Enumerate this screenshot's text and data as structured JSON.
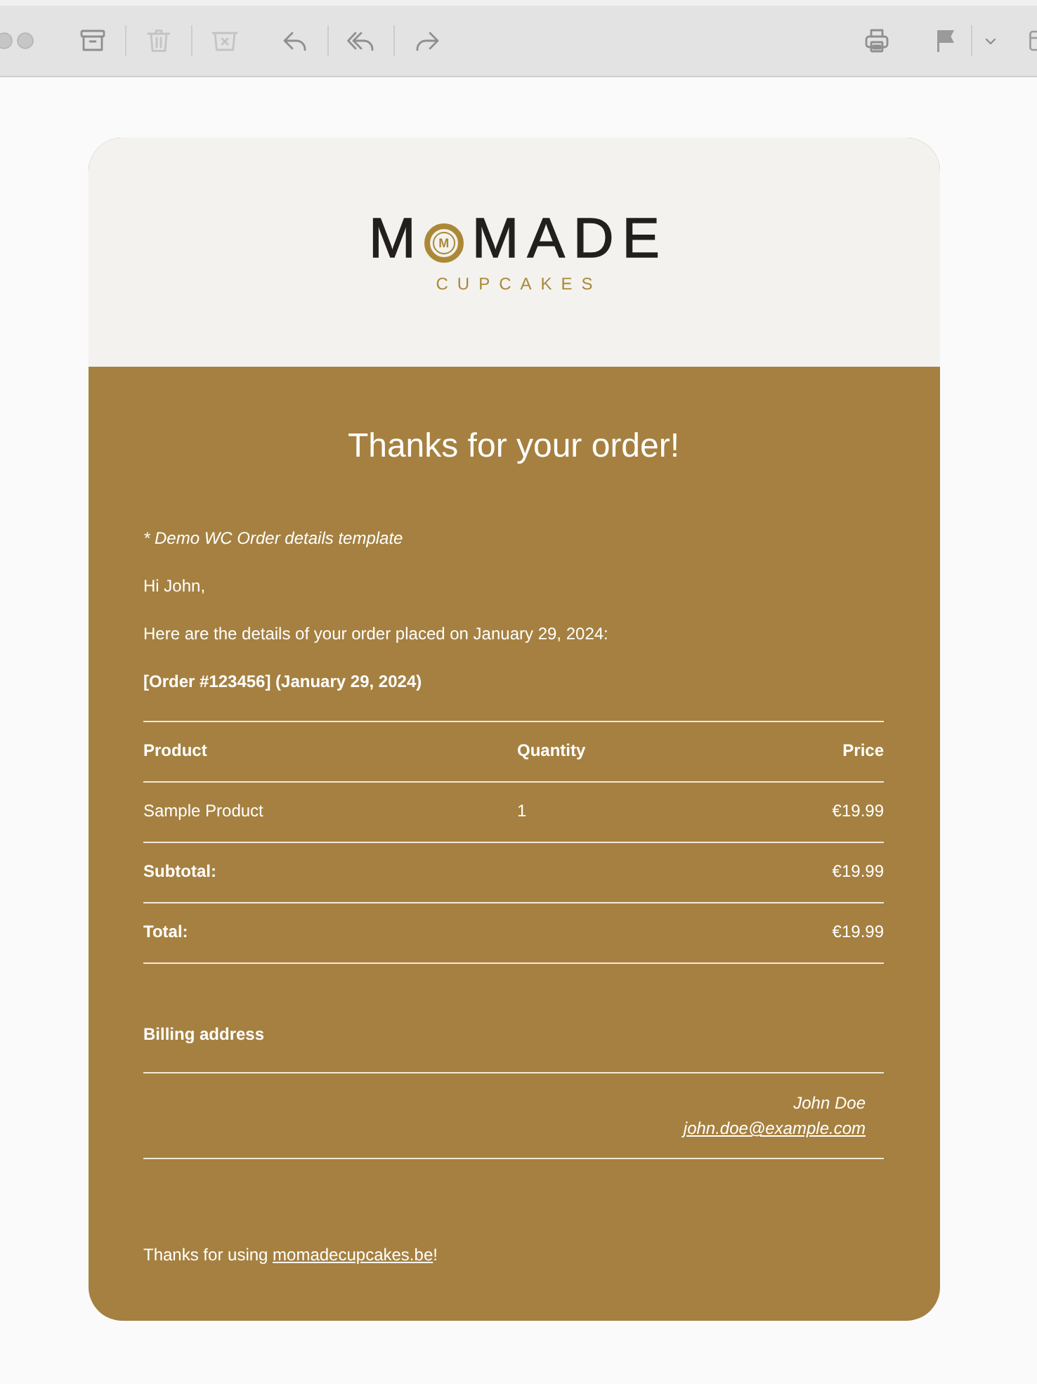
{
  "toolbar": {
    "left_groups": [
      {
        "buttons": [
          {
            "kind": "archive",
            "disabled": false
          },
          {
            "kind": "trash",
            "disabled": true
          },
          {
            "kind": "junk",
            "disabled": true
          }
        ]
      },
      {
        "buttons": [
          {
            "kind": "reply",
            "disabled": false
          },
          {
            "kind": "reply_all",
            "disabled": false
          },
          {
            "kind": "forward",
            "disabled": false
          }
        ]
      }
    ],
    "right_buttons": [
      {
        "kind": "print",
        "disabled": false
      },
      {
        "kind": "flag",
        "disabled": false
      },
      {
        "kind": "flag_menu",
        "disabled": false
      }
    ]
  },
  "email": {
    "logo": {
      "wordmark_start": "M",
      "badge": "M",
      "wordmark_end": "MADE",
      "tagline": "CUPCAKES"
    },
    "heading": "Thanks for your order!",
    "note": "* Demo WC Order details template",
    "greeting": "Hi John,",
    "intro": "Here are the details of your order placed on January 29, 2024:",
    "order_title": "[Order #123456] (January 29, 2024)",
    "table": {
      "columns": [
        "Product",
        "Quantity",
        "Price"
      ],
      "rows": [
        [
          "Sample Product",
          "1",
          "€19.99"
        ]
      ],
      "totals": [
        {
          "label": "Subtotal:",
          "value": "€19.99"
        },
        {
          "label": "Total:",
          "value": "€19.99"
        }
      ]
    },
    "billing": {
      "title": "Billing address",
      "name": "John Doe",
      "email": "john.doe@example.com"
    },
    "footer": {
      "text_before": "Thanks for using ",
      "link": "momadecupcakes.be",
      "text_after": "!"
    }
  }
}
